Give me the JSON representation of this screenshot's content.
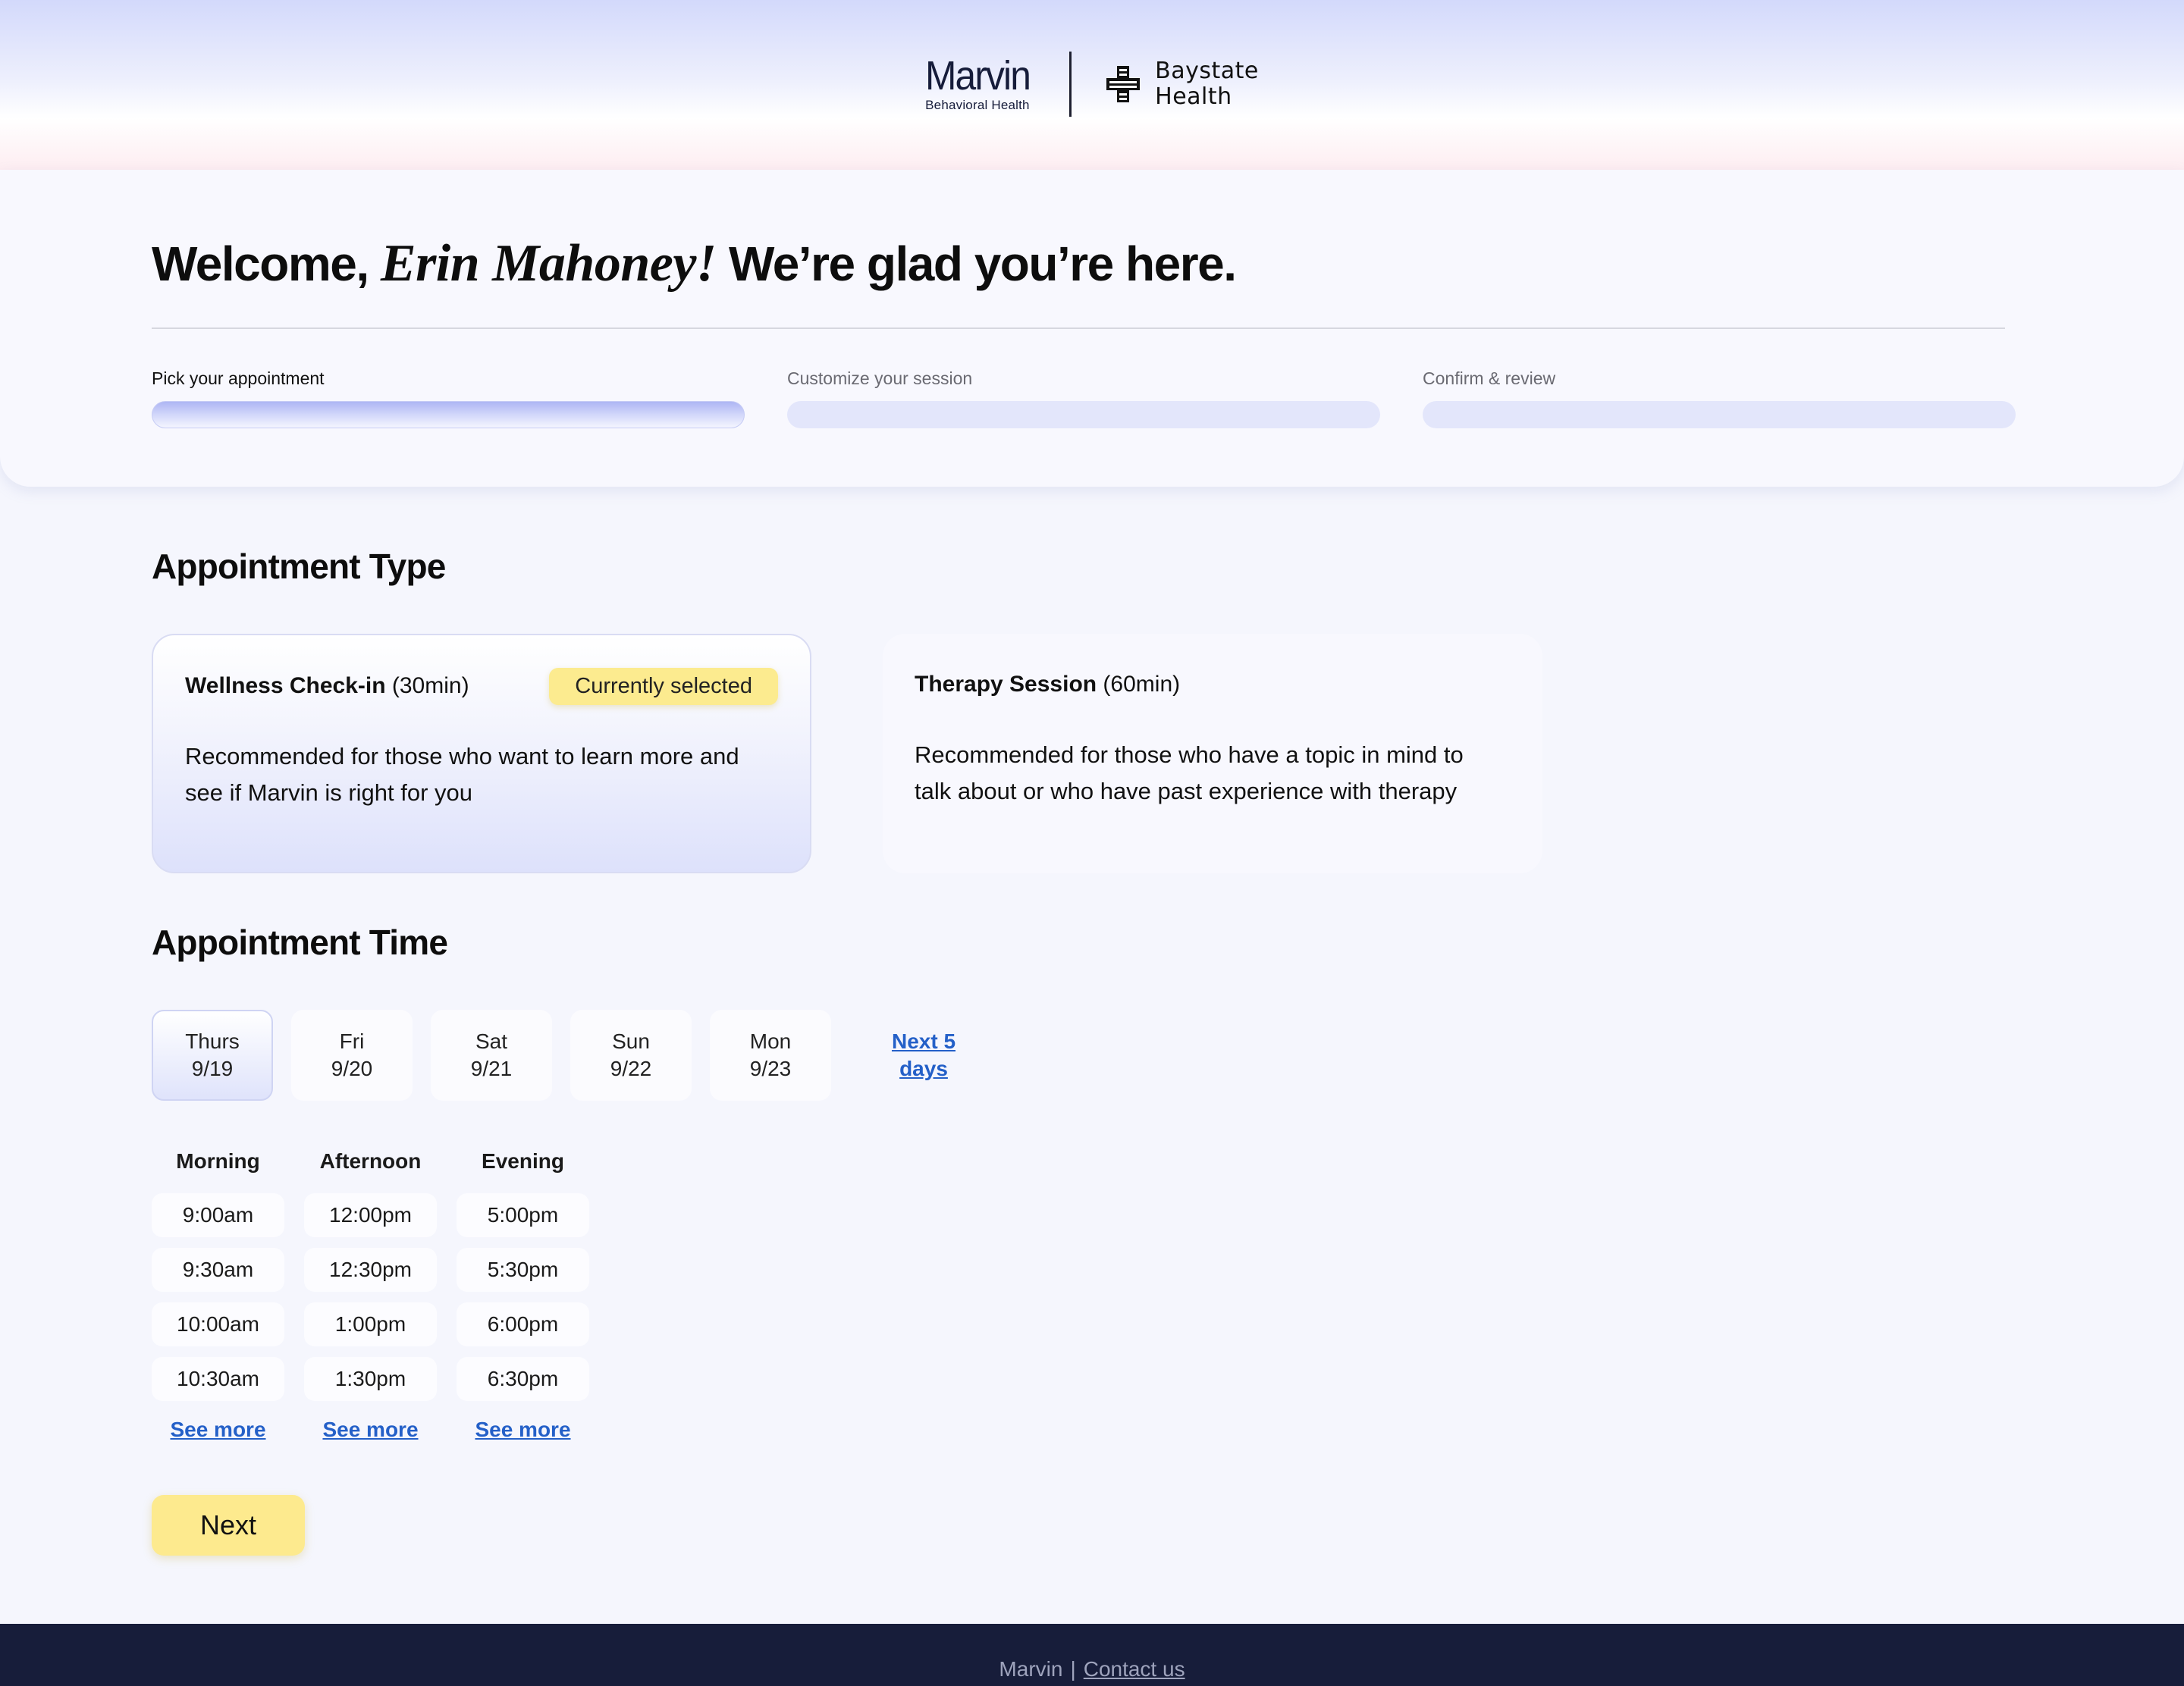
{
  "header": {
    "marvin_logo_text": "Marvin",
    "marvin_logo_sub": "Behavioral Health",
    "partner_line1": "Baystate",
    "partner_line2": "Health"
  },
  "welcome": {
    "prefix": "Welcome, ",
    "name": "Erin Mahoney!",
    "suffix": " We’re glad you’re here."
  },
  "steps": [
    {
      "label": "Pick your appointment",
      "active": true
    },
    {
      "label": "Customize your session",
      "active": false
    },
    {
      "label": "Confirm & review",
      "active": false
    }
  ],
  "appointment_type": {
    "title": "Appointment Type",
    "options": [
      {
        "name": "Wellness Check-in",
        "duration": " (30min)",
        "badge": "Currently selected",
        "description": "Recommended for those who want to learn more and see if Marvin is right for you",
        "selected": true
      },
      {
        "name": "Therapy Session",
        "duration": " (60min)",
        "description": "Recommended for those who have a topic in mind to talk about or who have past experience with therapy",
        "selected": false
      }
    ]
  },
  "appointment_time": {
    "title": "Appointment Time",
    "dates": [
      {
        "day": "Thurs",
        "date": "9/19",
        "active": true
      },
      {
        "day": "Fri",
        "date": "9/20",
        "active": false
      },
      {
        "day": "Sat",
        "date": "9/21",
        "active": false
      },
      {
        "day": "Sun",
        "date": "9/22",
        "active": false
      },
      {
        "day": "Mon",
        "date": "9/23",
        "active": false
      }
    ],
    "next_days_label": "Next 5 days",
    "columns": [
      {
        "heading": "Morning",
        "slots": [
          "9:00am",
          "9:30am",
          "10:00am",
          "10:30am"
        ],
        "see_more": "See more"
      },
      {
        "heading": "Afternoon",
        "slots": [
          "12:00pm",
          "12:30pm",
          "1:00pm",
          "1:30pm"
        ],
        "see_more": "See more"
      },
      {
        "heading": "Evening",
        "slots": [
          "5:00pm",
          "5:30pm",
          "6:00pm",
          "6:30pm"
        ],
        "see_more": "See more"
      }
    ]
  },
  "next_button": "Next",
  "footer": {
    "brand": "Marvin",
    "separator": "|",
    "contact": "Contact us"
  },
  "colors": {
    "accent_yellow": "#fdea8e",
    "link_blue": "#2460c8",
    "footer_bg": "#171d3a",
    "lavender": "#dfe3fb"
  }
}
